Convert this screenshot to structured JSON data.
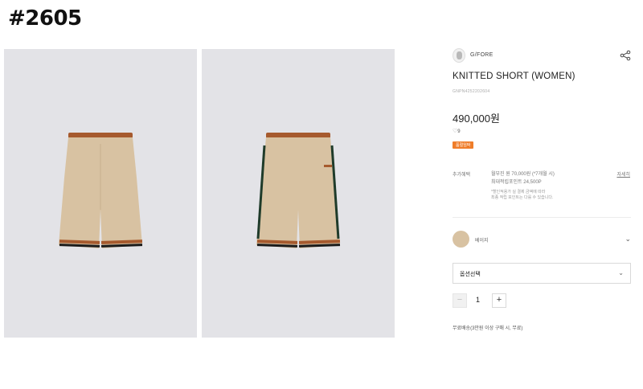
{
  "tag_label": "#2605",
  "brand": {
    "name": "G/FORE",
    "logo_icon": "brand-avatar-icon",
    "share_icon": "share-icon"
  },
  "product": {
    "title": "KNITTED SHORT (WOMEN)",
    "code": "GNPN4252202604",
    "price": "490,000원",
    "likes": "9",
    "badge": "품절임박"
  },
  "benefits": {
    "label": "추가혜택",
    "lines": [
      "월부진 원 70,000원 (*7개월 시)",
      "최대적립포인트 24,500P"
    ],
    "notes": [
      "*할인적용가 실 결제 금액에 따라",
      "최종 적립 포인트는 다를 수 있습니다."
    ],
    "details_link": "자세히"
  },
  "color_option": {
    "name": "베이지",
    "swatch_color": "#d8c2a2"
  },
  "option_select": {
    "label": "옵션선택"
  },
  "quantity": {
    "value": "1",
    "minus": "−",
    "plus": "+"
  },
  "shipping_note": "무료배송(3만원 이상 구매 시, 무료)",
  "photos": [
    "shorts-front",
    "shorts-back"
  ],
  "colors": {
    "badge": "#ef7d2a",
    "photo_bg": "#e3e3e7",
    "shorts": "#d8c2a2",
    "trim_brown": "#a65a2e"
  }
}
